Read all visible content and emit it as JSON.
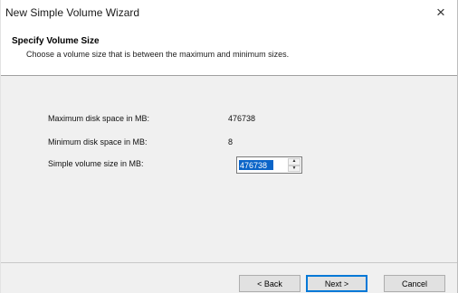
{
  "window": {
    "title": "New Simple Volume Wizard",
    "close_glyph": "×"
  },
  "header": {
    "title": "Specify Volume Size",
    "subtitle": "Choose a volume size that is between the maximum and minimum sizes."
  },
  "fields": {
    "max_label": "Maximum disk space in MB:",
    "max_value": "476738",
    "min_label": "Minimum disk space in MB:",
    "min_value": "8",
    "size_label": "Simple volume size in MB:",
    "size_value": "476738"
  },
  "spinner": {
    "up_icon": "▲",
    "down_icon": "▼"
  },
  "buttons": {
    "back": "< Back",
    "next": "Next >",
    "cancel": "Cancel"
  },
  "colors": {
    "selection": "#0a64c8",
    "default_button_border": "#0078d7"
  }
}
